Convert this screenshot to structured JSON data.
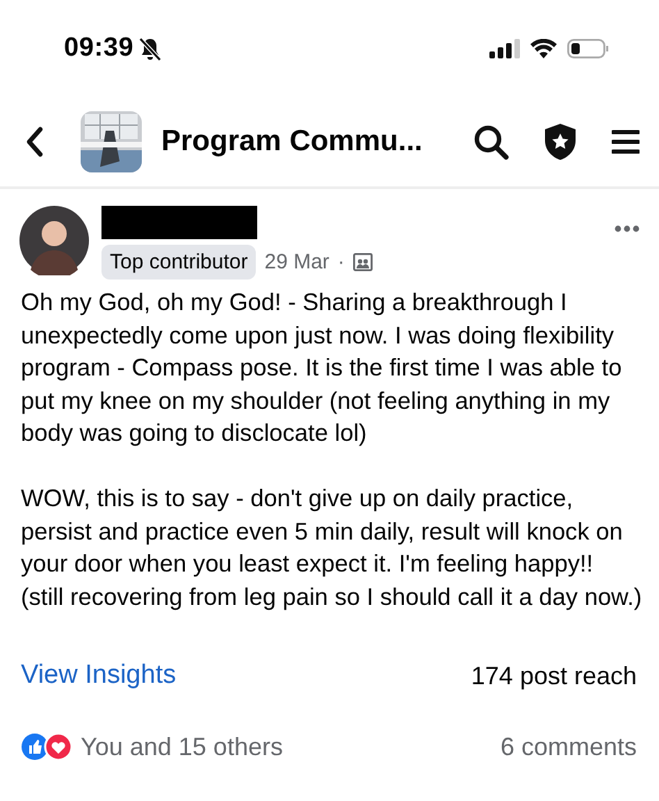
{
  "status_bar": {
    "time": "09:39",
    "silent": true
  },
  "header": {
    "title": "Program Commu..."
  },
  "post": {
    "badge": "Top contributor",
    "date": "29 Mar",
    "separator": "·",
    "paragraphs": [
      "Oh my God, oh my God! - Sharing a breakthrough I unexpectedly come upon just now. I was doing flexibility program - Compass pose. It is the first time I was able to put my knee on my shoulder (not feeling anything in my body was going to disclocate lol)",
      "WOW, this is to say - don't give up on daily practice, persist and practice even 5 min daily, result will knock on your door when you least expect it. I'm feeling happy!!",
      "(still recovering from leg pain so I should call it a day now.)"
    ],
    "insights_link": "View Insights",
    "reach": "174 post reach",
    "reactions": "You and 15 others",
    "comments": "6 comments"
  }
}
